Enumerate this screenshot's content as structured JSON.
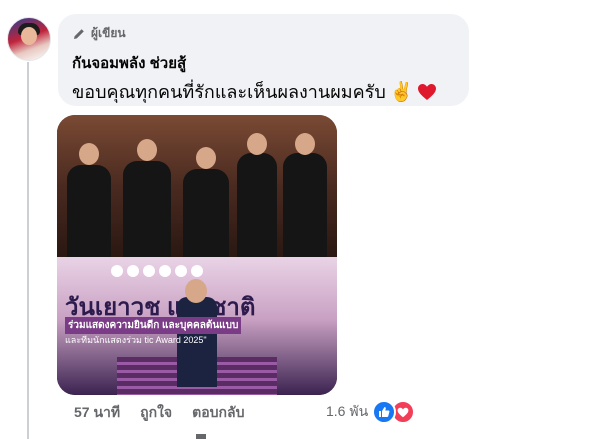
{
  "comment": {
    "badge_label": "ผู้เขียน",
    "author": "กันจอมพลัง ช่วยสู้",
    "text": "ขอบคุณทุกคนที่รักและเห็นผลงานผมครับ",
    "emoji_peace": "✌️"
  },
  "photo": {
    "banner_title": "วันเยาวช  แห่งชาติ",
    "banner_line2": "ร่วมแสดงความยินดีก          และบุคคลต้นแบบ",
    "banner_line3": "และทีมนักแสดงร่วม          tic Award 2025\""
  },
  "actions": {
    "time": "57 นาที",
    "like": "ถูกใจ",
    "reply": "ตอบกลับ"
  },
  "reactions": {
    "count": "1.6 พัน",
    "types": [
      "like-icon",
      "love-icon"
    ],
    "colors": {
      "like": "#1877f2",
      "love": "#f33e58"
    }
  }
}
